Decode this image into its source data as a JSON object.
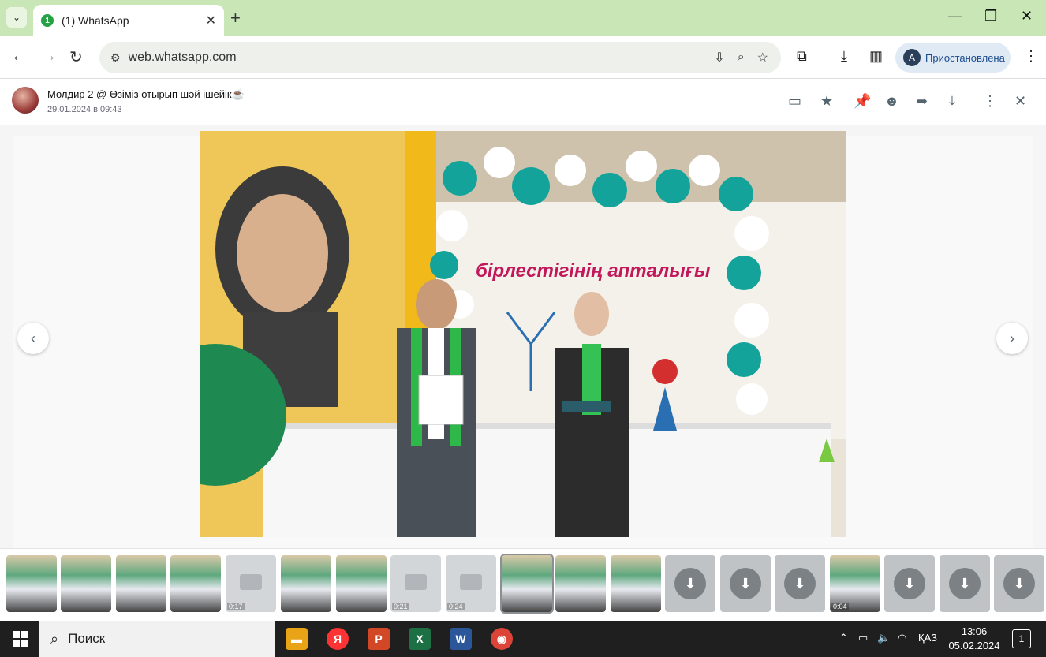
{
  "browser": {
    "tab_title": "(1) WhatsApp",
    "tab_badge": "1",
    "url": "web.whatsapp.com",
    "profile_initial": "A",
    "profile_status": "Приостановлена"
  },
  "viewer": {
    "sender": "Молдир 2 @ Өзіміз отырып шәй ішейік☕",
    "date": "29.01.2024 в 09:43",
    "photo_banner": "бірлестігінің апталығы",
    "thumbnails": [
      {
        "kind": "photo"
      },
      {
        "kind": "photo"
      },
      {
        "kind": "photo"
      },
      {
        "kind": "photo"
      },
      {
        "kind": "video",
        "duration": "0:17"
      },
      {
        "kind": "photo"
      },
      {
        "kind": "photo"
      },
      {
        "kind": "video",
        "duration": "0:21"
      },
      {
        "kind": "video",
        "duration": "0:24"
      },
      {
        "kind": "photo",
        "selected": true
      },
      {
        "kind": "photo"
      },
      {
        "kind": "photo"
      },
      {
        "kind": "download"
      },
      {
        "kind": "download"
      },
      {
        "kind": "download"
      },
      {
        "kind": "photo",
        "duration": "0:04"
      },
      {
        "kind": "download"
      },
      {
        "kind": "download"
      },
      {
        "kind": "download"
      }
    ]
  },
  "taskbar": {
    "search_placeholder": "Поиск",
    "language": "ҚАЗ",
    "time": "13:06",
    "date": "05.02.2024",
    "notifications": "1"
  },
  "colors": {
    "tabstrip": "#c9e6b6",
    "whatsapp_green": "#25a244",
    "taskbar": "#1f1f20"
  }
}
